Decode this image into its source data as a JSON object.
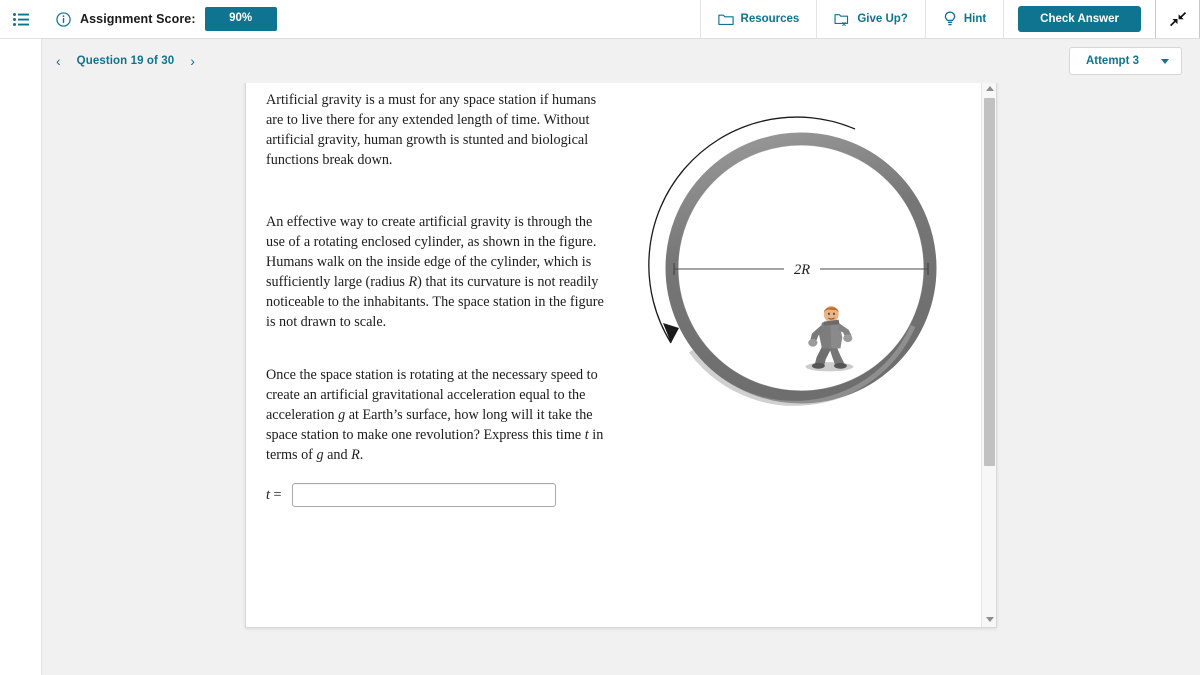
{
  "header": {
    "menu_icon": "hamburger-menu-icon",
    "info_icon": "info-circle-icon",
    "score_label": "Assignment Score:",
    "score_value": "90%",
    "resources_label": "Resources",
    "resources_icon": "folder-icon",
    "give_up_label": "Give Up?",
    "give_up_icon": "folder-x-icon",
    "hint_label": "Hint",
    "hint_icon": "lightbulb-icon",
    "check_answer_label": "Check Answer",
    "expand_icon": "collapse-arrows-icon",
    "accent_color": "#0e7490"
  },
  "subnav": {
    "prev_icon": "chevron-left-icon",
    "next_icon": "chevron-right-icon",
    "question_label": "Question 19 of 30",
    "attempt_label": "Attempt 3",
    "attempt_caret_icon": "caret-down-icon"
  },
  "question": {
    "paragraphs": [
      "Artificial gravity is a must for any space station if humans are to live there for any extended length of time. Without artificial gravity, human growth is stunted and biological functions break down.",
      "An effective way to create artificial gravity is through the use of a rotating enclosed cylinder, as shown in the figure. Humans walk on the inside edge of the cylinder, which is sufficiently large (radius R) that its curvature is not readily noticeable to the inhabitants. The space station in the figure is not drawn to scale.",
      "Once the space station is rotating at the necessary speed to create an artificial gravitational acceleration equal to the acceleration g at Earth's surface, how long will it take the space station to make one revolution? Express this time t in terms of g and R."
    ],
    "answer_label": "t =",
    "answer_value": "",
    "answer_placeholder": ""
  },
  "figure": {
    "name": "rotating-space-station-diagram",
    "diameter_label": "2R",
    "ring_color": "#7a7a7a",
    "ring_shadow_color": "#9a9a9a",
    "rotation_arrow": "counterclockwise-rotation-arrow",
    "astronaut": "walking-person-figure"
  },
  "scrollbar": {
    "up_icon": "scroll-up-arrow-icon",
    "down_icon": "scroll-down-arrow-icon",
    "thumb": "scroll-thumb"
  }
}
